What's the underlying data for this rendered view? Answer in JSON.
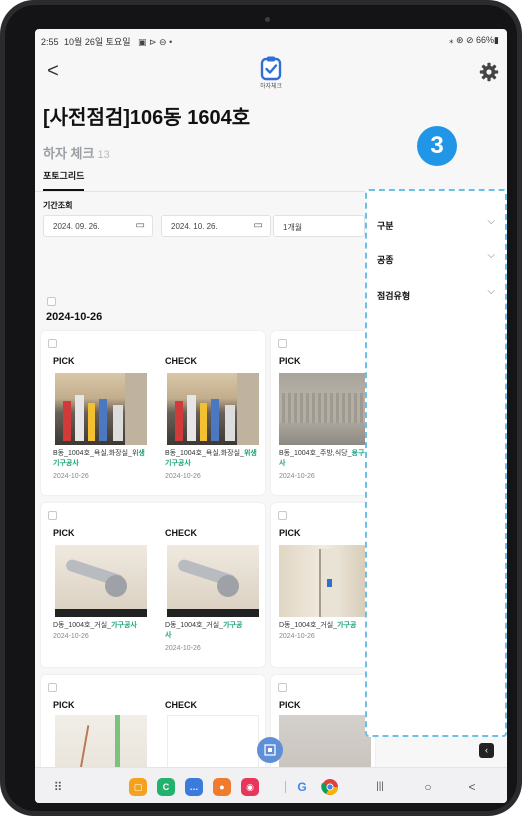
{
  "status_bar": {
    "time": "2:55",
    "date": "10월 26일 토요일",
    "icons_left": "▣ ⊳ ⊖ •",
    "icons_right": "⁎ ⊛ ⊘ 66%▮"
  },
  "header": {
    "back_label": "<",
    "logo_text": "하자체크",
    "settings_icon": "gear-icon"
  },
  "page_title": "[사전점검]106동 1604호",
  "section": {
    "title": "하자 체크",
    "count": "13"
  },
  "tab": {
    "label": "포토그리드"
  },
  "period": {
    "label": "기간조회",
    "start_date": "2024. 09. 26.",
    "end_date": "2024. 10. 26.",
    "range": "1개월"
  },
  "group": {
    "date": "2024-10-26"
  },
  "cards": [
    {
      "label": "PICK",
      "caption_pre": "B동_1004호_욕실,화장실_위",
      "caption_hl": "생기구공사",
      "caption_line2": "",
      "date": "2024-10-26"
    },
    {
      "label": "CHECK",
      "caption_pre": "B동_1004호_욕실,화장실_",
      "caption_hl": "위생기구공사",
      "caption_line2": "",
      "date": "2024-10-26"
    },
    {
      "label": "PICK",
      "caption_pre": "B동_1004호_주방,식당_",
      "caption_hl": "용구공사",
      "caption_line2": "",
      "date": "2024-10-26"
    },
    {
      "label": "PICK",
      "caption_pre": "D동_1004호_거실_",
      "caption_hl": "가구공사",
      "caption_line2": "",
      "date": "2024-10-26"
    },
    {
      "label": "CHECK",
      "caption_pre": "D동_1004호_거실_",
      "caption_hl": "가구공",
      "caption_line2": "사",
      "date": "2024-10-26"
    },
    {
      "label": "PICK",
      "caption_pre": "D동_1004호_거실_",
      "caption_hl": "가구공",
      "caption_line2": "",
      "date": "2024-10-26"
    },
    {
      "label": "PICK"
    },
    {
      "label": "CHECK"
    },
    {
      "label": "PICK"
    }
  ],
  "filter_panel": {
    "badge": "3",
    "items": [
      {
        "label": "구분"
      },
      {
        "label": "공종"
      },
      {
        "label": "점검유형"
      }
    ],
    "chevron": "⌵",
    "toggle_icon": "‹"
  },
  "nav_bar": {
    "apps": [
      {
        "name": "files",
        "color": "#f4a21e",
        "glyph": "▢"
      },
      {
        "name": "phone",
        "color": "#23b26d",
        "glyph": "C"
      },
      {
        "name": "messages",
        "color": "#3a7bdc",
        "glyph": "…"
      },
      {
        "name": "contacts",
        "color": "#f07a2e",
        "glyph": "●"
      },
      {
        "name": "camera",
        "color": "#e8365a",
        "glyph": "◉"
      }
    ],
    "recent_label": "|||",
    "home_label": "○",
    "back_label": "<"
  },
  "colors": {
    "highlight_green": "#1aa37a",
    "badge_blue": "#2196e6",
    "panel_dash": "#6cc0e8"
  }
}
